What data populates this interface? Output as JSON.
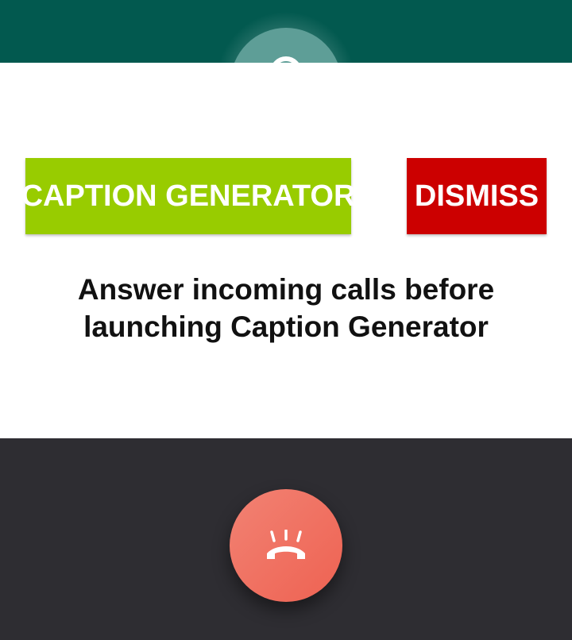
{
  "caller": {
    "avatar_icon": "person-icon",
    "header_color": "#02594f"
  },
  "dialog": {
    "caption_button_label": "CAPTION GENERATOR",
    "caption_button_color": "#98cc00",
    "dismiss_button_label": "DISMISS",
    "dismiss_button_color": "#cc0000",
    "message": "Answer incoming calls before launching Caption Generator"
  },
  "call_controls": {
    "end_call_icon": "hang-up-ringing-icon",
    "end_call_color": "#ee6252",
    "background_color": "#2e2d32"
  }
}
